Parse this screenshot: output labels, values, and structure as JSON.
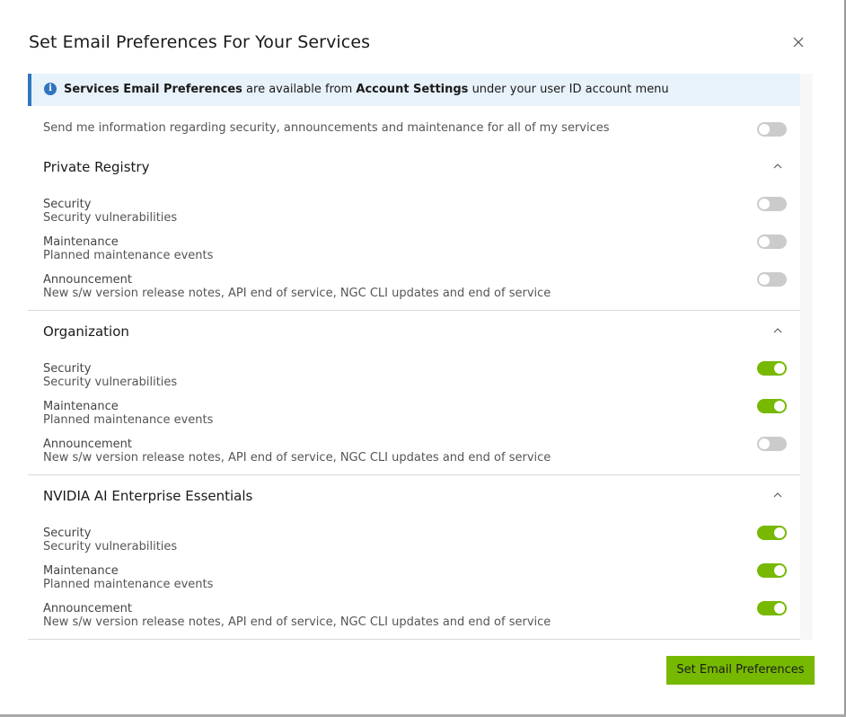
{
  "dialog": {
    "title": "Set Email Preferences For Your Services",
    "close_icon": "close-icon"
  },
  "info_banner": {
    "icon": "info-icon",
    "icon_glyph": "i",
    "bold1": "Services Email Preferences",
    "text1": " are available from ",
    "bold2": "Account Settings",
    "text2": " under your user ID account menu"
  },
  "global_toggle": {
    "label": "Send me information regarding security, announcements and maintenance for all of my services",
    "on": false
  },
  "sections": [
    {
      "title": "Private Registry",
      "expanded": true,
      "items": [
        {
          "label": "Security",
          "description": "Security vulnerabilities",
          "on": false
        },
        {
          "label": "Maintenance",
          "description": "Planned maintenance events",
          "on": false
        },
        {
          "label": "Announcement",
          "description": "New s/w version release notes, API end of service, NGC CLI updates and end of service",
          "on": false
        }
      ]
    },
    {
      "title": "Organization",
      "expanded": true,
      "items": [
        {
          "label": "Security",
          "description": "Security vulnerabilities",
          "on": true
        },
        {
          "label": "Maintenance",
          "description": "Planned maintenance events",
          "on": true
        },
        {
          "label": "Announcement",
          "description": "New s/w version release notes, API end of service, NGC CLI updates and end of service",
          "on": false
        }
      ]
    },
    {
      "title": "NVIDIA AI Enterprise Essentials",
      "expanded": true,
      "items": [
        {
          "label": "Security",
          "description": "Security vulnerabilities",
          "on": true
        },
        {
          "label": "Maintenance",
          "description": "Planned maintenance events",
          "on": true
        },
        {
          "label": "Announcement",
          "description": "New s/w version release notes, API end of service, NGC CLI updates and end of service",
          "on": true
        }
      ]
    }
  ],
  "footer": {
    "submit_label": "Set Email Preferences"
  },
  "colors": {
    "accent": "#76b900",
    "info": "#2f75c0",
    "info_bg": "#e8f2fb",
    "toggle_off": "#cbcbcb"
  }
}
